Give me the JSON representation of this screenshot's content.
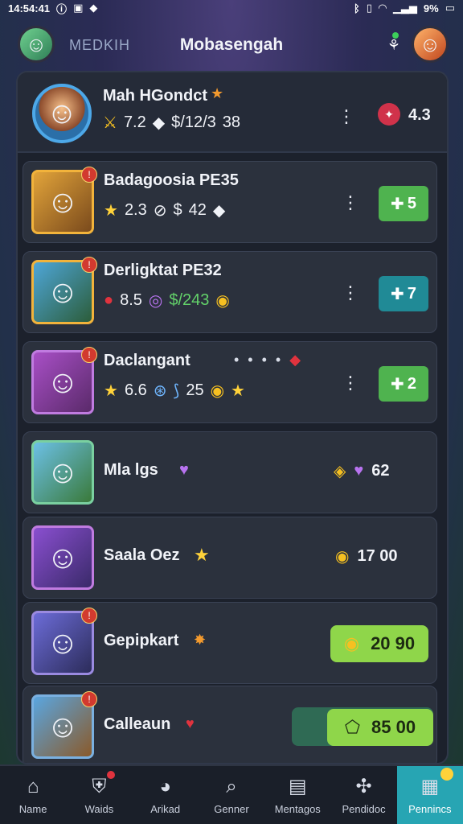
{
  "status_bar": {
    "time": "14:54:41",
    "left_icons": [
      "alert-icon",
      "image-icon",
      "shield-icon"
    ],
    "battery": "9%"
  },
  "top_bar": {
    "left_label": "MEDKIH",
    "title": "Mobasengah"
  },
  "player": {
    "name": "Mah HGondct",
    "stat_a": "7.2",
    "stat_b": "$/12/3",
    "stat_c": "38",
    "right_value": "4.3"
  },
  "rows": [
    {
      "name": "Badagoosia PE35",
      "s1": "2.3",
      "s2": "$",
      "s3": "42",
      "action": "5",
      "action_color": "#4fb34f"
    },
    {
      "name": "Derligktat PE32",
      "s1": "8.5",
      "s2": "$/243",
      "s3": "",
      "action": "7",
      "action_color": "#208a96"
    },
    {
      "name": "Daclangant",
      "s1": "6.6",
      "s2": "25",
      "s3": "",
      "action": "2",
      "action_color": "#4fb34f"
    },
    {
      "name": "Mla lgs",
      "reward": "62"
    },
    {
      "name": "Saala Oez",
      "reward": "17 00"
    },
    {
      "name": "Gepipkart",
      "reward": "20 90"
    },
    {
      "name": "Calleaun",
      "reward": "85 00"
    }
  ],
  "nav": [
    {
      "label": "Name",
      "icon": "home-icon"
    },
    {
      "label": "Waids",
      "icon": "shield-icon"
    },
    {
      "label": "Arikad",
      "icon": "chat-icon"
    },
    {
      "label": "Genner",
      "icon": "search-icon"
    },
    {
      "label": "Mentagos",
      "icon": "book-icon"
    },
    {
      "label": "Pendidoc",
      "icon": "gamepad-icon"
    },
    {
      "label": "Pennincs",
      "icon": "gift-icon"
    }
  ],
  "colors": {
    "accent": "#27a5b3",
    "green_button": "#4fb34f",
    "teal_button": "#208a96",
    "reward_green": "#8fd64a"
  }
}
